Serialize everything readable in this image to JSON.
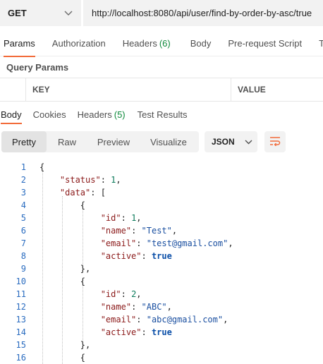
{
  "request": {
    "method": "GET",
    "url": "http://localhost:8080/api/user/find-by-order-by-asc/true"
  },
  "request_tabs": [
    {
      "label": "Params",
      "count": "",
      "active": true
    },
    {
      "label": "Authorization",
      "count": "",
      "active": false
    },
    {
      "label": "Headers",
      "count": "(6)",
      "active": false
    },
    {
      "label": "Body",
      "count": "",
      "active": false
    },
    {
      "label": "Pre-request Script",
      "count": "",
      "active": false
    },
    {
      "label": "Te",
      "count": "",
      "active": false
    }
  ],
  "query_params": {
    "title": "Query Params",
    "columns": [
      "KEY",
      "VALUE"
    ]
  },
  "response_tabs": [
    {
      "label": "Body",
      "count": "",
      "active": true
    },
    {
      "label": "Cookies",
      "count": "",
      "active": false
    },
    {
      "label": "Headers",
      "count": "(5)",
      "active": false
    },
    {
      "label": "Test Results",
      "count": "",
      "active": false
    }
  ],
  "view_modes": [
    "Pretty",
    "Raw",
    "Preview",
    "Visualize"
  ],
  "active_view": "Pretty",
  "format": "JSON",
  "icons": {
    "method_dropdown": "chevron-down-icon",
    "format_dropdown": "chevron-down-icon",
    "wrap": "wrap-lines-icon"
  },
  "colors": {
    "accent": "#f26b3a",
    "count": "#0f8a3c",
    "line_numbers": "#2a6cc0",
    "json_key": "#8b1a1a",
    "json_string": "#1a4fa0"
  },
  "code_lines": [
    {
      "n": "1",
      "text": "{"
    },
    {
      "n": "2",
      "text": "    \"status\": 1,"
    },
    {
      "n": "3",
      "text": "    \"data\": ["
    },
    {
      "n": "4",
      "text": "        {"
    },
    {
      "n": "5",
      "text": "            \"id\": 1,"
    },
    {
      "n": "6",
      "text": "            \"name\": \"Test\","
    },
    {
      "n": "7",
      "text": "            \"email\": \"test@gmail.com\","
    },
    {
      "n": "8",
      "text": "            \"active\": true"
    },
    {
      "n": "9",
      "text": "        },"
    },
    {
      "n": "10",
      "text": "        {"
    },
    {
      "n": "11",
      "text": "            \"id\": 2,"
    },
    {
      "n": "12",
      "text": "            \"name\": \"ABC\","
    },
    {
      "n": "13",
      "text": "            \"email\": \"abc@gmail.com\","
    },
    {
      "n": "14",
      "text": "            \"active\": true"
    },
    {
      "n": "15",
      "text": "        },"
    },
    {
      "n": "16",
      "text": "        {"
    }
  ]
}
